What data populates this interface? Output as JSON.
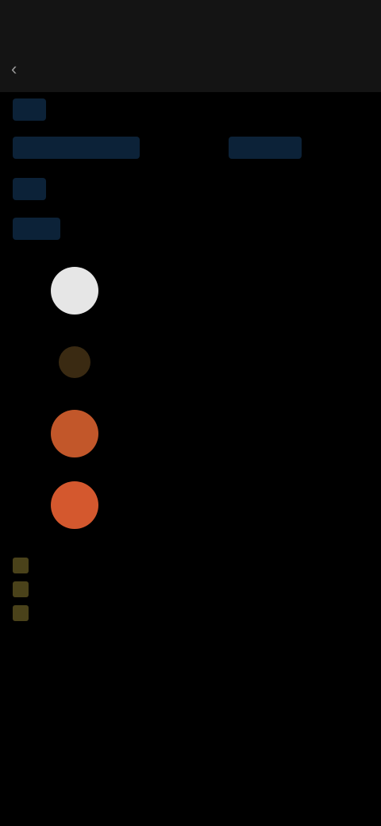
{
  "status_bar": {
    "left_text": "",
    "right_text": ""
  },
  "header": {
    "title": ""
  },
  "meta_rows": [
    {
      "tag": "",
      "text": ""
    },
    {
      "tag": "",
      "text": "",
      "tag2": "",
      "text2": ""
    },
    {
      "tag": "",
      "text": ""
    },
    {
      "tag": "",
      "text": ""
    }
  ],
  "list": [
    {
      "rank": "",
      "name": "",
      "value_a": "",
      "value_b": "",
      "value_c": "",
      "avatar_color": "#e6e6e6"
    },
    {
      "rank": "",
      "name": "",
      "value_a": "",
      "value_b": "",
      "value_c": "",
      "avatar_color": "#3a2a12"
    },
    {
      "rank": "",
      "name": "",
      "value_a": "",
      "value_b": "",
      "value_c": "",
      "avatar_color": "#c2572a"
    },
    {
      "rank": "",
      "name": "",
      "value_a": "",
      "value_b": "",
      "value_c": "",
      "avatar_color": "#d4582e"
    }
  ],
  "footer": {
    "line1": "",
    "line2": "",
    "line3": ""
  },
  "colors": {
    "background": "#000000",
    "bar": "#141414",
    "tag": "#0c2238",
    "accent_yellow": "#4a421a"
  }
}
